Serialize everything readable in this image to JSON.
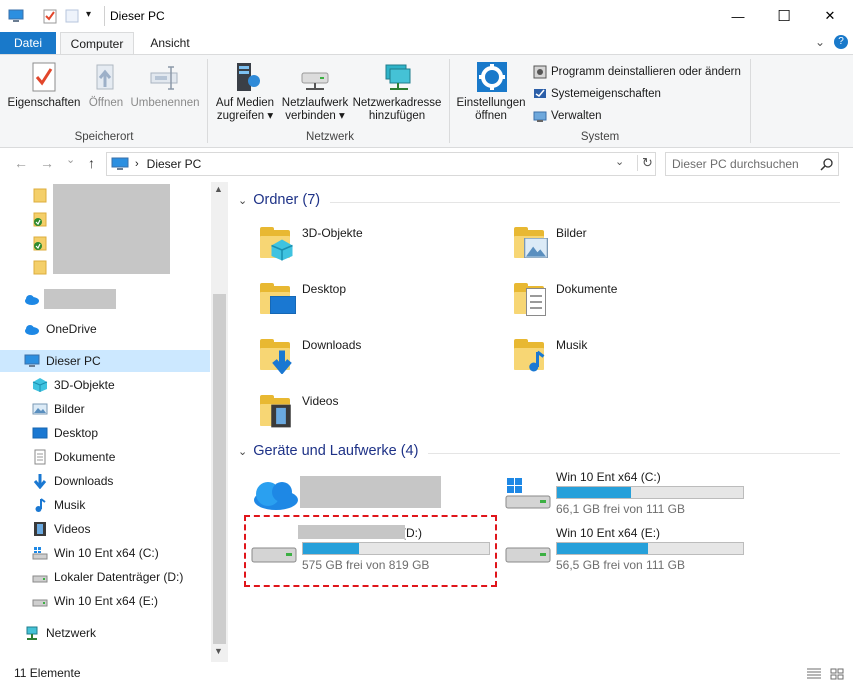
{
  "window": {
    "title": "Dieser PC",
    "minimize": "—",
    "maximize": "☐",
    "close": "✕"
  },
  "tabs": {
    "file": "Datei",
    "computer": "Computer",
    "view": "Ansicht",
    "collapse": "⌄",
    "help": "?"
  },
  "ribbon": {
    "location_group": "Speicherort",
    "network_group": "Netzwerk",
    "system_group": "System",
    "properties": "Eigenschaften",
    "open": "Öffnen",
    "rename": "Umbenennen",
    "media_line1": "Auf Medien",
    "media_line2": "zugreifen",
    "netdrive_line1": "Netzlaufwerk",
    "netdrive_line2": "verbinden",
    "netaddr_line1": "Netzwerkadresse",
    "netaddr_line2": "hinzufügen",
    "settings_line1": "Einstellungen",
    "settings_line2": "öffnen",
    "uninstall": "Programm deinstallieren oder ändern",
    "sysprops": "Systemeigenschaften",
    "manage": "Verwalten"
  },
  "address": {
    "back": "←",
    "forward": "→",
    "recent": "⌄",
    "up": "↑",
    "path": "Dieser PC",
    "dropdown": "⌄",
    "refresh": "↻",
    "search_placeholder": "Dieser PC durchsuchen"
  },
  "nav": {
    "onedrive": "OneDrive",
    "this_pc": "Dieser PC",
    "objects3d": "3D-Objekte",
    "pictures": "Bilder",
    "desktop": "Desktop",
    "documents": "Dokumente",
    "downloads": "Downloads",
    "music": "Musik",
    "videos": "Videos",
    "drive_c": "Win 10 Ent x64 (C:)",
    "drive_d": "Lokaler Datenträger (D:)",
    "drive_e": "Win 10 Ent x64 (E:)",
    "network": "Netzwerk"
  },
  "content": {
    "folders_heading": "Ordner (7)",
    "devices_heading": "Geräte und Laufwerke (4)",
    "folders": {
      "objects3d": "3D-Objekte",
      "pictures": "Bilder",
      "desktop": "Desktop",
      "documents": "Dokumente",
      "downloads": "Downloads",
      "music": "Musik",
      "videos": "Videos"
    },
    "drives": {
      "c_name": "Win 10 Ent x64 (C:)",
      "c_info": "66,1 GB frei von 111 GB",
      "c_used_fraction": 0.4,
      "d_name": "(D:)",
      "d_info": "575 GB frei von 819 GB",
      "d_used_fraction": 0.3,
      "e_name": "Win 10 Ent x64 (E:)",
      "e_info": "56,5 GB frei von 111 GB",
      "e_used_fraction": 0.49
    }
  },
  "status": {
    "count": "11 Elemente"
  },
  "colors": {
    "accent": "#1979ca",
    "bar_fill": "#26a0da",
    "selection": "#cce8ff",
    "highlight_border": "#e0151b",
    "heading": "#1e3287"
  }
}
